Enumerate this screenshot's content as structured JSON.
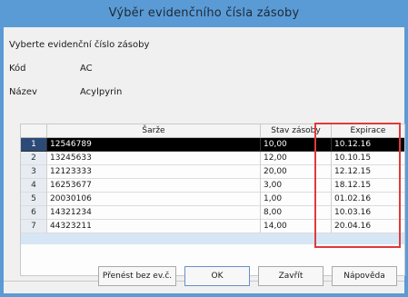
{
  "window": {
    "title": "Výběr evidenčního čísla zásoby"
  },
  "form": {
    "instruction": "Vyberte evidenční číslo zásoby",
    "kod_label": "Kód",
    "kod_value": "AC",
    "nazev_label": "Název",
    "nazev_value": "Acylpyrin"
  },
  "table": {
    "columns": [
      "Šarže",
      "Stav zásoby",
      "Expirace"
    ],
    "rows": [
      {
        "n": "1",
        "sarze": "12546789",
        "stav": "10,00",
        "exp": "10.12.16"
      },
      {
        "n": "2",
        "sarze": "13245633",
        "stav": "12,00",
        "exp": "10.10.15"
      },
      {
        "n": "3",
        "sarze": "12123333",
        "stav": "20,00",
        "exp": "12.12.15"
      },
      {
        "n": "4",
        "sarze": "16253677",
        "stav": "3,00",
        "exp": "18.12.15"
      },
      {
        "n": "5",
        "sarze": "20030106",
        "stav": "1,00",
        "exp": "01.02.16"
      },
      {
        "n": "6",
        "sarze": "14321234",
        "stav": "8,00",
        "exp": "10.03.16"
      },
      {
        "n": "7",
        "sarze": "44323211",
        "stav": "14,00",
        "exp": "20.04.16"
      }
    ],
    "selected_row": 1
  },
  "buttons": {
    "prenest": "Přenést bez ev.č.",
    "ok": "OK",
    "zavrit": "Zavřít",
    "napoveda": "Nápověda"
  },
  "colors": {
    "titlebar": "#5b9bd5",
    "highlight_frame": "#e03a3a",
    "selected_row": "#000000"
  }
}
